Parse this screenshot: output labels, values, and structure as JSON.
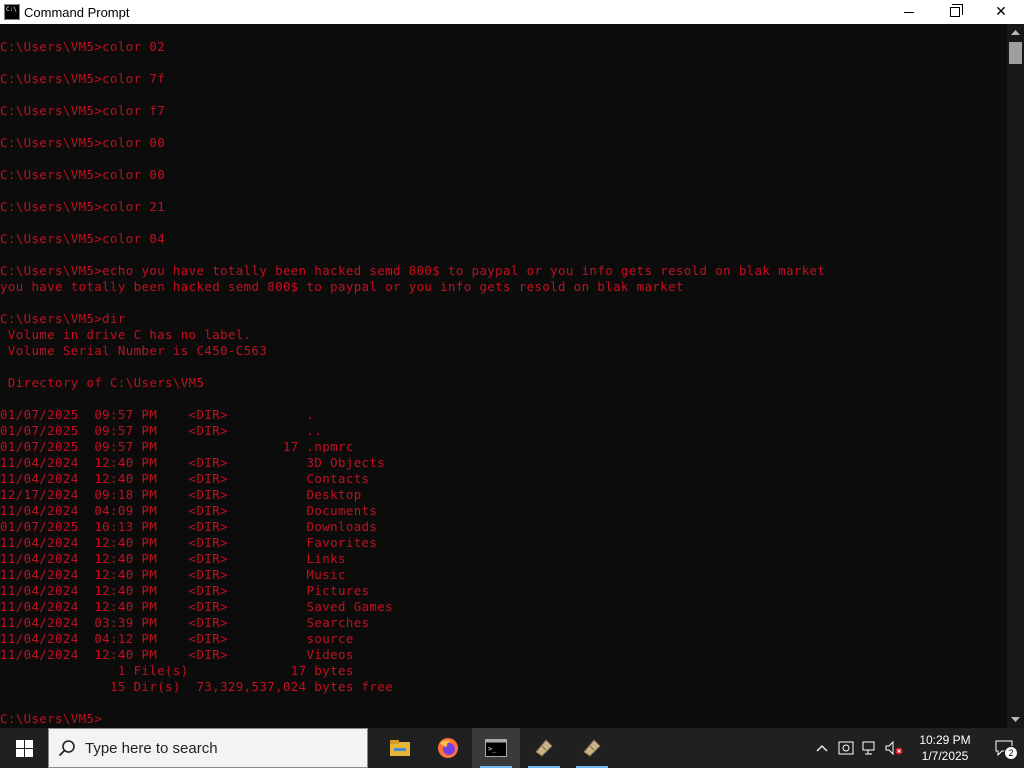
{
  "window": {
    "title": "Command Prompt",
    "minimize_label": "minimize",
    "maximize_label": "restore",
    "close_label": "✕"
  },
  "console": {
    "text_color": "#c50f1f",
    "background": "#0c0c0c",
    "lines": [
      "C:\\Users\\VM5>color 02",
      "",
      "C:\\Users\\VM5>color 7f",
      "",
      "C:\\Users\\VM5>color f7",
      "",
      "C:\\Users\\VM5>color 00",
      "",
      "C:\\Users\\VM5>color 00",
      "",
      "C:\\Users\\VM5>color 21",
      "",
      "C:\\Users\\VM5>color 04",
      "",
      "C:\\Users\\VM5>echo you have totally been hacked semd 800$ to paypal or you info gets resold on blak market",
      "you have totally been hacked semd 800$ to paypal or you info gets resold on blak market",
      "",
      "C:\\Users\\VM5>dir",
      " Volume in drive C has no label.",
      " Volume Serial Number is C450-C563",
      "",
      " Directory of C:\\Users\\VM5",
      "",
      "01/07/2025  09:57 PM    <DIR>          .",
      "01/07/2025  09:57 PM    <DIR>          ..",
      "01/07/2025  09:57 PM                17 .npmrc",
      "11/04/2024  12:40 PM    <DIR>          3D Objects",
      "11/04/2024  12:40 PM    <DIR>          Contacts",
      "12/17/2024  09:18 PM    <DIR>          Desktop",
      "11/04/2024  04:09 PM    <DIR>          Documents",
      "01/07/2025  10:13 PM    <DIR>          Downloads",
      "11/04/2024  12:40 PM    <DIR>          Favorites",
      "11/04/2024  12:40 PM    <DIR>          Links",
      "11/04/2024  12:40 PM    <DIR>          Music",
      "11/04/2024  12:40 PM    <DIR>          Pictures",
      "11/04/2024  12:40 PM    <DIR>          Saved Games",
      "11/04/2024  03:39 PM    <DIR>          Searches",
      "11/04/2024  04:12 PM    <DIR>          source",
      "11/04/2024  12:40 PM    <DIR>          Videos",
      "               1 File(s)             17 bytes",
      "              15 Dir(s)  73,329,537,024 bytes free",
      "",
      "C:\\Users\\VM5>"
    ]
  },
  "taskbar": {
    "search_placeholder": "Type here to search",
    "apps": [
      {
        "name": "file-explorer-icon",
        "active": false
      },
      {
        "name": "firefox-icon",
        "active": false
      },
      {
        "name": "command-prompt-icon",
        "active": true
      },
      {
        "name": "app-icon-1",
        "active": false
      },
      {
        "name": "app-icon-2",
        "active": false
      }
    ],
    "clock_time": "10:29 PM",
    "clock_date": "1/7/2025",
    "notification_count": "2"
  }
}
